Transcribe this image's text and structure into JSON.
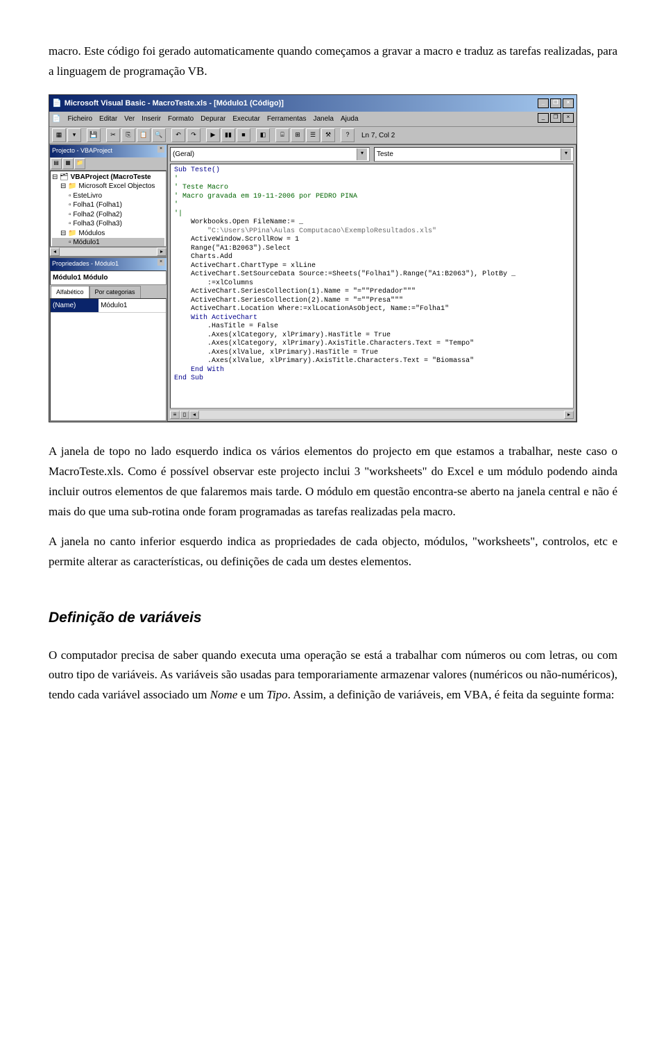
{
  "para1": "macro. Este código foi gerado automaticamente quando começamos a gravar a macro e traduz as tarefas realizadas, para a linguagem de programação VB.",
  "screenshot": {
    "title": "Microsoft Visual Basic - MacroTeste.xls - [Módulo1 (Código)]",
    "menu": [
      "Ficheiro",
      "Editar",
      "Ver",
      "Inserir",
      "Formato",
      "Depurar",
      "Executar",
      "Ferramentas",
      "Janela",
      "Ajuda"
    ],
    "toolbar_text": "Ln 7, Col 2",
    "project_panel_title": "Projecto - VBAProject",
    "tree": {
      "root": "VBAProject (MacroTeste",
      "folder_objects": "Microsoft Excel Objectos",
      "estelivro": "EsteLivro",
      "folha1": "Folha1 (Folha1)",
      "folha2": "Folha2 (Folha2)",
      "folha3": "Folha3 (Folha3)",
      "folder_modules": "Módulos",
      "modulo1": "Módulo1"
    },
    "prop_panel_title": "Propriedades - Módulo1",
    "prop_header": "Módulo1 Módulo",
    "prop_tabs": [
      "Alfabético",
      "Por categorias"
    ],
    "prop_name_label": "(Name)",
    "prop_name_value": "Módulo1",
    "combo_left": "(Geral)",
    "combo_right": "Teste",
    "code_lines": [
      {
        "t": "kw",
        "x": "Sub Teste()"
      },
      {
        "t": "cm",
        "x": "'"
      },
      {
        "t": "cm",
        "x": "' Teste Macro"
      },
      {
        "t": "cm",
        "x": "' Macro gravada em 19-11-2006 por PEDRO PINA"
      },
      {
        "t": "cm",
        "x": "'"
      },
      {
        "t": "cm",
        "x": "'|"
      },
      {
        "t": "",
        "x": "    Workbooks.Open FileName:= _"
      },
      {
        "t": "str",
        "x": "        \"C:\\Users\\PPina\\Aulas Computacao\\ExemploResultados.xls\""
      },
      {
        "t": "",
        "x": "    ActiveWindow.ScrollRow = 1"
      },
      {
        "t": "",
        "x": "    Range(\"A1:B2063\").Select"
      },
      {
        "t": "",
        "x": "    Charts.Add"
      },
      {
        "t": "",
        "x": "    ActiveChart.ChartType = xlLine"
      },
      {
        "t": "",
        "x": "    ActiveChart.SetSourceData Source:=Sheets(\"Folha1\").Range(\"A1:B2063\"), PlotBy _"
      },
      {
        "t": "",
        "x": "        :=xlColumns"
      },
      {
        "t": "",
        "x": "    ActiveChart.SeriesCollection(1).Name = \"=\"\"Predador\"\"\""
      },
      {
        "t": "",
        "x": "    ActiveChart.SeriesCollection(2).Name = \"=\"\"Presa\"\"\""
      },
      {
        "t": "",
        "x": "    ActiveChart.Location Where:=xlLocationAsObject, Name:=\"Folha1\""
      },
      {
        "t": "kw",
        "x": "    With ActiveChart"
      },
      {
        "t": "",
        "x": "        .HasTitle = False"
      },
      {
        "t": "",
        "x": "        .Axes(xlCategory, xlPrimary).HasTitle = True"
      },
      {
        "t": "",
        "x": "        .Axes(xlCategory, xlPrimary).AxisTitle.Characters.Text = \"Tempo\""
      },
      {
        "t": "",
        "x": "        .Axes(xlValue, xlPrimary).HasTitle = True"
      },
      {
        "t": "",
        "x": "        .Axes(xlValue, xlPrimary).AxisTitle.Characters.Text = \"Biomassa\""
      },
      {
        "t": "kw",
        "x": "    End With"
      },
      {
        "t": "kw",
        "x": "End Sub"
      }
    ]
  },
  "para2": "A janela de topo no lado esquerdo indica os vários elementos do projecto em que estamos a trabalhar, neste caso o MacroTeste.xls. Como é possível observar este projecto inclui 3 \"worksheets\" do Excel e um  módulo podendo ainda incluir outros elementos de que falaremos mais tarde. O módulo em questão encontra-se aberto na janela central e não é mais do que uma sub-rotina onde foram programadas as tarefas realizadas pela macro.",
  "para3": "A janela no canto inferior esquerdo indica as propriedades de cada objecto, módulos, \"worksheets\", controlos, etc e permite alterar as características, ou definições de cada um destes elementos.",
  "heading": "Definição de variáveis",
  "para4a": "O computador precisa de saber quando executa uma operação se está a trabalhar com números ou com letras, ou com outro tipo de variáveis. As variáveis são usadas para temporariamente armazenar valores (numéricos ou não-numéricos), tendo cada variável associado um ",
  "para4_nome": "Nome",
  "para4b": " e um ",
  "para4_tipo": "Tipo",
  "para4c": ". Assim, a definição de variáveis, em VBA, é feita da seguinte forma:"
}
